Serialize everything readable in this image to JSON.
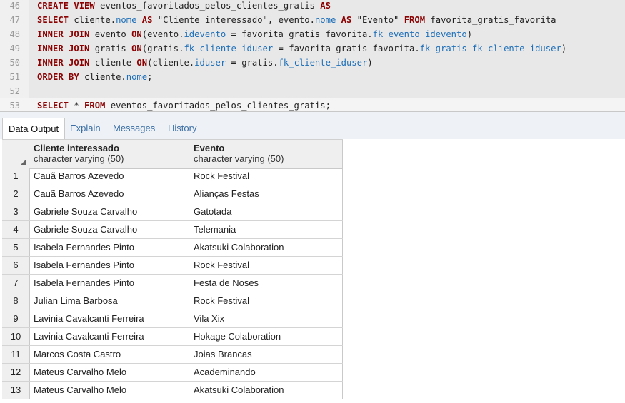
{
  "editor": {
    "lines": [
      {
        "num": "46",
        "segments": [
          [
            "kw",
            "CREATE VIEW"
          ],
          [
            "",
            " eventos_favoritados_pelos_clientes_gratis "
          ],
          [
            "kw",
            "AS"
          ]
        ]
      },
      {
        "num": "47",
        "segments": [
          [
            "kw",
            "SELECT"
          ],
          [
            "",
            " cliente."
          ],
          [
            "fd",
            "nome"
          ],
          [
            "",
            " "
          ],
          [
            "kw",
            "AS"
          ],
          [
            "",
            " \"Cliente interessado\", evento."
          ],
          [
            "fd",
            "nome"
          ],
          [
            "",
            " "
          ],
          [
            "kw",
            "AS"
          ],
          [
            "",
            " \"Evento\" "
          ],
          [
            "kw",
            "FROM"
          ],
          [
            "",
            " favorita_gratis_favorita"
          ]
        ]
      },
      {
        "num": "48",
        "segments": [
          [
            "kw",
            "INNER JOIN"
          ],
          [
            "",
            " evento "
          ],
          [
            "kw",
            "ON"
          ],
          [
            "",
            "(evento."
          ],
          [
            "fd",
            "idevento"
          ],
          [
            "",
            " = favorita_gratis_favorita."
          ],
          [
            "fd",
            "fk_evento_idevento"
          ],
          [
            "",
            ")"
          ]
        ]
      },
      {
        "num": "49",
        "segments": [
          [
            "kw",
            "INNER JOIN"
          ],
          [
            "",
            " gratis "
          ],
          [
            "kw",
            "ON"
          ],
          [
            "",
            "(gratis."
          ],
          [
            "fd",
            "fk_cliente_iduser"
          ],
          [
            "",
            " = favorita_gratis_favorita."
          ],
          [
            "fd",
            "fk_gratis_fk_cliente_iduser"
          ],
          [
            "",
            ")"
          ]
        ]
      },
      {
        "num": "50",
        "segments": [
          [
            "kw",
            "INNER JOIN"
          ],
          [
            "",
            " cliente "
          ],
          [
            "kw",
            "ON"
          ],
          [
            "",
            "(cliente."
          ],
          [
            "fd",
            "iduser"
          ],
          [
            "",
            " = gratis."
          ],
          [
            "fd",
            "fk_cliente_iduser"
          ],
          [
            "",
            ")"
          ]
        ]
      },
      {
        "num": "51",
        "segments": [
          [
            "kw",
            "ORDER BY"
          ],
          [
            "",
            " cliente."
          ],
          [
            "fd",
            "nome"
          ],
          [
            "",
            ";"
          ]
        ]
      },
      {
        "num": "52",
        "segments": []
      },
      {
        "num": "53",
        "segments": [
          [
            "kw",
            "SELECT"
          ],
          [
            "",
            " * "
          ],
          [
            "kw",
            "FROM"
          ],
          [
            "",
            " eventos_favoritados_pelos_clientes_gratis;"
          ]
        ]
      }
    ]
  },
  "tabs": [
    {
      "label": "Data Output",
      "active": true
    },
    {
      "label": "Explain",
      "active": false
    },
    {
      "label": "Messages",
      "active": false
    },
    {
      "label": "History",
      "active": false
    }
  ],
  "grid": {
    "columns": [
      {
        "title": "Cliente interessado",
        "type": "character varying (50)"
      },
      {
        "title": "Evento",
        "type": "character varying (50)"
      }
    ],
    "rows": [
      {
        "n": "1",
        "cliente": "Cauã Barros Azevedo",
        "evento": "Rock Festival"
      },
      {
        "n": "2",
        "cliente": "Cauã Barros Azevedo",
        "evento": "Alianças Festas"
      },
      {
        "n": "3",
        "cliente": "Gabriele Souza Carvalho",
        "evento": "Gatotada"
      },
      {
        "n": "4",
        "cliente": "Gabriele Souza Carvalho",
        "evento": "Telemania"
      },
      {
        "n": "5",
        "cliente": "Isabela Fernandes Pinto",
        "evento": "Akatsuki Colaboration"
      },
      {
        "n": "6",
        "cliente": "Isabela Fernandes Pinto",
        "evento": "Rock Festival"
      },
      {
        "n": "7",
        "cliente": "Isabela Fernandes Pinto",
        "evento": "Festa de Noses"
      },
      {
        "n": "8",
        "cliente": "Julian Lima Barbosa",
        "evento": "Rock Festival"
      },
      {
        "n": "9",
        "cliente": "Lavinia Cavalcanti Ferreira",
        "evento": "Vila Xix"
      },
      {
        "n": "10",
        "cliente": "Lavinia Cavalcanti Ferreira",
        "evento": "Hokage Colaboration"
      },
      {
        "n": "11",
        "cliente": "Marcos Costa Castro",
        "evento": "Joias Brancas"
      },
      {
        "n": "12",
        "cliente": "Mateus Carvalho Melo",
        "evento": "Academinando"
      },
      {
        "n": "13",
        "cliente": "Mateus Carvalho Melo",
        "evento": "Akatsuki Colaboration"
      }
    ]
  }
}
